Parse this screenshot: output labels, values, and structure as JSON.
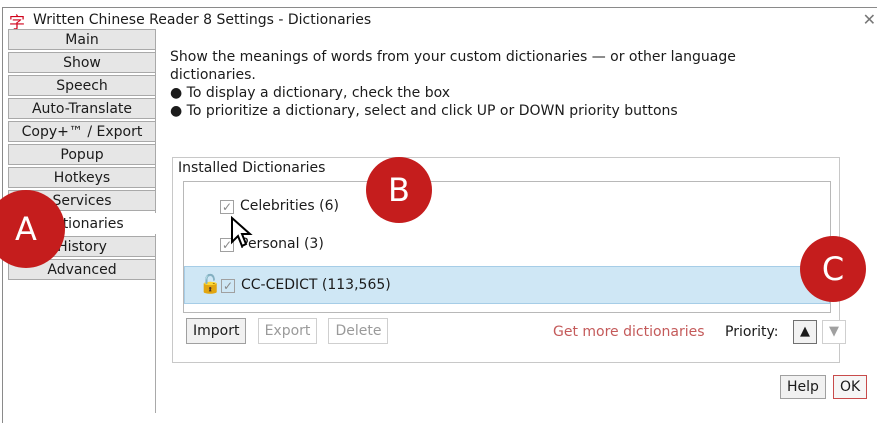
{
  "window": {
    "title": "Written Chinese Reader 8 Settings - Dictionaries",
    "app_icon_glyph": "字",
    "close_glyph": "✕"
  },
  "sidebar": {
    "tabs": [
      {
        "label": "Main"
      },
      {
        "label": "Show"
      },
      {
        "label": "Speech"
      },
      {
        "label": "Auto-Translate"
      },
      {
        "label": "Copy+™ / Export"
      },
      {
        "label": "Popup"
      },
      {
        "label": "Hotkeys"
      },
      {
        "label": "Services"
      },
      {
        "label": "Dictionaries",
        "active": true
      },
      {
        "label": "History"
      },
      {
        "label": "Advanced"
      }
    ]
  },
  "content": {
    "description_line1": "Show the meanings of words from your custom dictionaries — or other language",
    "description_line2": "dictionaries.",
    "bullet1": "● To display a dictionary, check the box",
    "bullet2": "● To prioritize a dictionary, select and click UP or DOWN priority buttons"
  },
  "installed": {
    "group_title": "Installed Dictionaries",
    "dictionaries": [
      {
        "label": "Celebrities (6)",
        "checked": true
      },
      {
        "label": "Personal (3)",
        "checked": true
      },
      {
        "label": "CC-CEDICT (113,565)",
        "checked": true,
        "selected": true,
        "locked": true
      }
    ]
  },
  "actions": {
    "import_label": "Import",
    "export_label": "Export",
    "delete_label": "Delete",
    "more_link": "Get more dictionaries",
    "priority_label": "Priority:",
    "up_glyph": "▲",
    "down_glyph": "▼",
    "help_label": "Help",
    "ok_label": "OK"
  },
  "annotations": {
    "a": "A",
    "b": "B",
    "c": "C"
  },
  "colors": {
    "accent_red": "#c51d1d",
    "selected_row": "#cfe7f5",
    "link_red": "#c45a5a"
  }
}
